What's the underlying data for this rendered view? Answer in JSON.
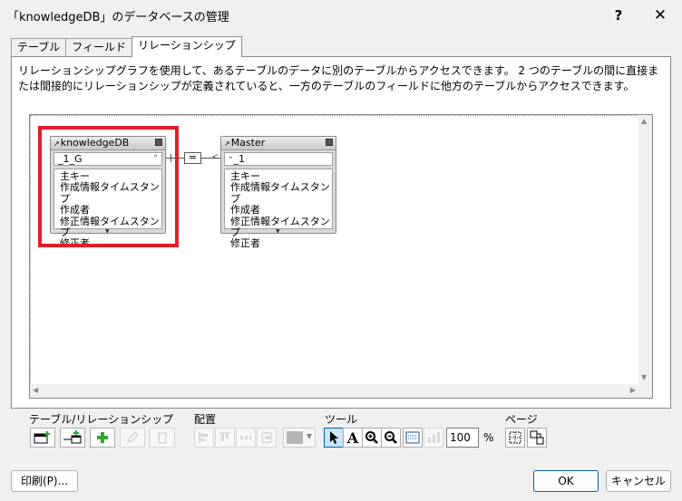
{
  "window": {
    "title": "「knowledgeDB」のデータベースの管理",
    "help": "?",
    "close": "✕"
  },
  "tabs": [
    {
      "label": "テーブル",
      "active": false
    },
    {
      "label": "フィールド",
      "active": false
    },
    {
      "label": "リレーションシップ",
      "active": true
    }
  ],
  "description": "リレーションシップグラフを使用して、あるテーブルのデータに別のテーブルからアクセスできます。 2 つのテーブルの間に直接または間接的にリレーションシップが定義されていると、一方のテーブルのフィールドに他方のテーブルからアクセスできます。",
  "graph": {
    "tables": [
      {
        "name": "knowledgeDB",
        "key_field": "_1_G",
        "fields": [
          "主キー",
          "作成情報タイムスタンプ",
          "作成者",
          "修正情報タイムスタンプ",
          "修正者"
        ]
      },
      {
        "name": "Master",
        "key_field": "_1",
        "fields": [
          "主キー",
          "作成情報タイムスタンプ",
          "作成者",
          "修正情報タイムスタンプ",
          "修正者"
        ]
      }
    ],
    "relation_operator": "=",
    "highlight_color": "#e01e2a"
  },
  "toolbar": {
    "groups": {
      "tables": "テーブル/リレーションシップ",
      "arrange": "配置",
      "tools": "ツール",
      "page": "ページ"
    },
    "zoom": "100",
    "zoom_unit": "%"
  },
  "footer": {
    "print": "印刷(P)...",
    "ok": "OK",
    "cancel": "キャンセル"
  }
}
